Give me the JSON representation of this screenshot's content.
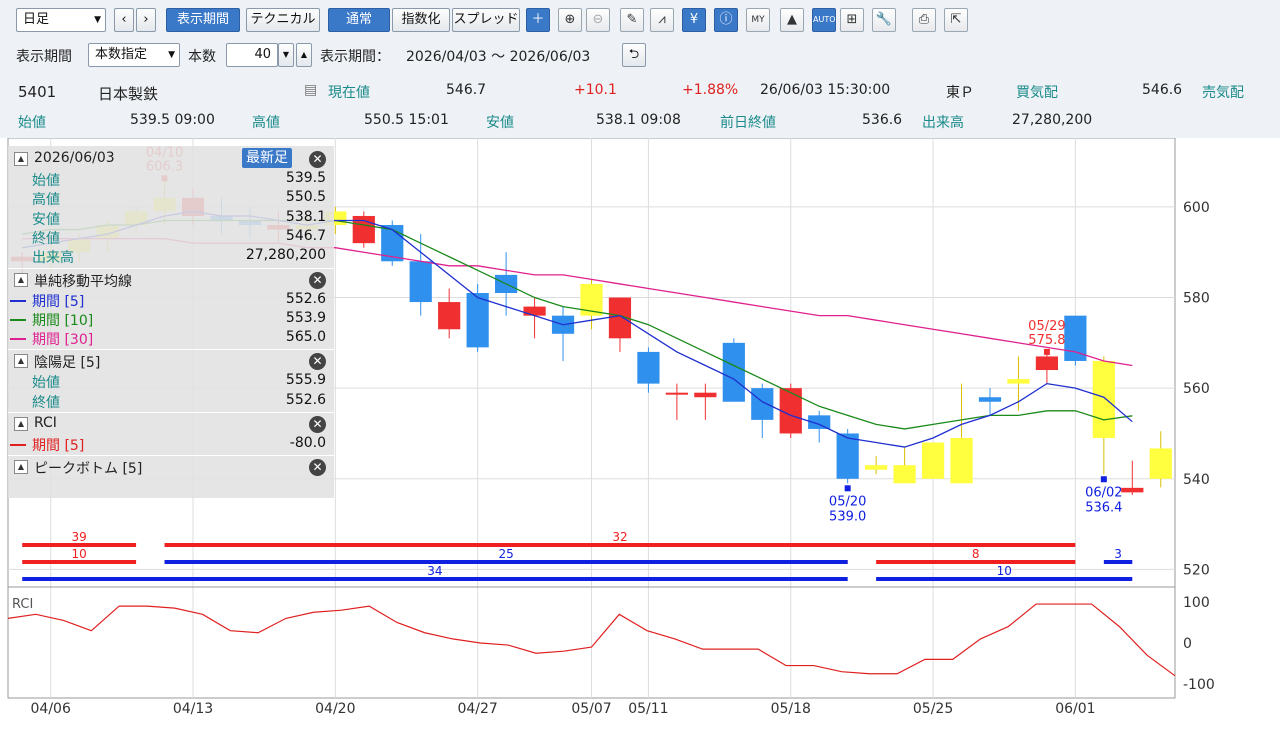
{
  "toolbar": {
    "period_select": "日足",
    "prev": "‹",
    "next": "›",
    "btn_period": "表示期間",
    "btn_tech": "テクニカル",
    "btn_normal": "通常",
    "btn_index": "指数化",
    "btn_spread": "スプレッド",
    "icons": [
      "plus-icon",
      "zoom-in-icon",
      "zoom-out-icon",
      "pencil-icon",
      "chart-compare-icon",
      "yen-icon",
      "info-icon",
      "my-chart-icon",
      "area-chart-icon",
      "auto-fit-icon",
      "tick-chart-icon",
      "wrench-icon",
      "print-icon",
      "export-icon"
    ]
  },
  "row2": {
    "label_period": "表示期間",
    "mode": "本数指定",
    "label_count": "本数",
    "count": "40",
    "label_range": "表示期間：",
    "range": "2026/04/03 〜 2026/06/03"
  },
  "quote": {
    "code": "5401",
    "name": "日本製鉄",
    "current_label": "現在値",
    "current": "546.7",
    "change": "+10.1",
    "change_pct": "+1.88%",
    "datetime": "26/06/03 15:30:00",
    "market": "東Ｐ",
    "bid_label": "買気配",
    "bid": "546.6",
    "ask_label": "売気配",
    "open_label": "始値",
    "open": "539.5 09:00",
    "high_label": "高値",
    "high": "550.5 15:01",
    "low_label": "安値",
    "low": "538.1 09:08",
    "prev_label": "前日終値",
    "prev": "536.6",
    "vol_label": "出来高",
    "vol": "27,280,200"
  },
  "panel": {
    "date": "2026/06/03",
    "latest_btn": "最新足",
    "rows": [
      [
        "始値",
        "539.5"
      ],
      [
        "高値",
        "550.5"
      ],
      [
        "安値",
        "538.1"
      ],
      [
        "終値",
        "546.7"
      ],
      [
        "出来高",
        "27,280,200"
      ]
    ],
    "sma_title": "単純移動平均線",
    "sma": [
      [
        "期間 [5]",
        "552.6",
        "#1f2fd0"
      ],
      [
        "期間 [10]",
        "553.9",
        "#1a8a1a"
      ],
      [
        "期間 [30]",
        "565.0",
        "#e0208f"
      ]
    ],
    "inyou_title": "陰陽足 [5]",
    "inyou": [
      [
        "始値",
        "555.9"
      ],
      [
        "終値",
        "552.6"
      ]
    ],
    "rci_title": "RCI",
    "rci": [
      [
        "期間 [5]",
        "-80.0",
        "#e02020"
      ]
    ],
    "peak_title": "ピークボトム [5]"
  },
  "chart_data": {
    "type": "candlestick",
    "dates": [
      "04/03",
      "04/06",
      "04/07",
      "04/08",
      "04/09",
      "04/10",
      "04/13",
      "04/14",
      "04/15",
      "04/16",
      "04/17",
      "04/20",
      "04/21",
      "04/22",
      "04/23",
      "04/24",
      "04/27",
      "04/28",
      "04/30",
      "05/01",
      "05/07",
      "05/08",
      "05/11",
      "05/12",
      "05/13",
      "05/14",
      "05/15",
      "05/18",
      "05/19",
      "05/20",
      "05/21",
      "05/22",
      "05/25",
      "05/26",
      "05/27",
      "05/28",
      "05/29",
      "06/01",
      "06/02",
      "06/03"
    ],
    "candles": [
      [
        589,
        590,
        585,
        588
      ],
      [
        588,
        592,
        586,
        590
      ],
      [
        590,
        594,
        588,
        593
      ],
      [
        593,
        597,
        590,
        596
      ],
      [
        596,
        600,
        594,
        599
      ],
      [
        599,
        606.3,
        596,
        602
      ],
      [
        602,
        604,
        596,
        598
      ],
      [
        598,
        602,
        594,
        597
      ],
      [
        597,
        600,
        593,
        596
      ],
      [
        596,
        599,
        592,
        595
      ],
      [
        595,
        598,
        592,
        596
      ],
      [
        596,
        600,
        594,
        599
      ],
      [
        598,
        599,
        591,
        592
      ],
      [
        596,
        597,
        587,
        588
      ],
      [
        588,
        594,
        576,
        579
      ],
      [
        579,
        582,
        571,
        573
      ],
      [
        581,
        583,
        568,
        569
      ],
      [
        585,
        590,
        576,
        581
      ],
      [
        578,
        580,
        571,
        576
      ],
      [
        576,
        578,
        566,
        572
      ],
      [
        576,
        584,
        573,
        583
      ],
      [
        580,
        580,
        568,
        571
      ],
      [
        568,
        569,
        559,
        561
      ],
      [
        559,
        561,
        553,
        559
      ],
      [
        559,
        561,
        553,
        558
      ],
      [
        570,
        571,
        557,
        557
      ],
      [
        560,
        561,
        549,
        553
      ],
      [
        560,
        561,
        549,
        550
      ],
      [
        554,
        555,
        548,
        551
      ],
      [
        550,
        551,
        539,
        540
      ],
      [
        542,
        545,
        541,
        543
      ],
      [
        539,
        547,
        542,
        543
      ],
      [
        540,
        548,
        543,
        548
      ],
      [
        539,
        561,
        549,
        549
      ],
      [
        558,
        560,
        554,
        557
      ],
      [
        561,
        567,
        555,
        562
      ],
      [
        567,
        568,
        561,
        564
      ],
      [
        576,
        575.8,
        565,
        566
      ],
      [
        549,
        567,
        541,
        566
      ],
      [
        538,
        544,
        536.4,
        537
      ],
      [
        540,
        550.5,
        538.1,
        546.7
      ]
    ],
    "sma5": [
      591,
      592,
      593,
      594,
      596,
      598,
      599,
      598,
      598,
      597,
      596,
      597,
      597,
      595,
      590,
      585,
      580,
      578,
      576,
      574,
      575,
      576,
      572,
      568,
      565,
      562,
      557,
      554,
      552,
      549,
      548,
      547,
      549,
      552,
      554,
      557,
      561,
      560,
      558,
      552.6
    ],
    "sma10": [
      594,
      595,
      595,
      596,
      596,
      597,
      597,
      597,
      597,
      597,
      597,
      597,
      596,
      595,
      592,
      589,
      586,
      583,
      580,
      578,
      577,
      576,
      574,
      571,
      568,
      565,
      562,
      559,
      556,
      554,
      552,
      551,
      552,
      553,
      554,
      554,
      555,
      555,
      553,
      553.9
    ],
    "sma30": [
      593,
      593,
      593,
      593,
      593,
      593,
      592,
      592,
      592,
      592,
      591,
      591,
      590,
      589,
      588,
      587,
      587,
      586,
      585,
      585,
      584,
      583,
      582,
      581,
      580,
      579,
      578,
      577,
      576,
      576,
      575,
      574,
      573,
      572,
      571,
      570,
      569,
      568,
      566,
      565.0
    ],
    "peak_labels": [
      {
        "text": "04/10",
        "value": "606.3"
      },
      {
        "text": "05/29",
        "value": "575.8"
      }
    ],
    "bottom_labels": [
      {
        "text": "05/20",
        "value": "539.0"
      },
      {
        "text": "06/02",
        "value": "536.4"
      }
    ],
    "price_axis": [
      600,
      580,
      560,
      540,
      520
    ],
    "ylim": [
      517,
      613
    ],
    "trend_red": [
      {
        "label": "39"
      },
      {
        "label": "32"
      }
    ],
    "trend_red2": [
      {
        "label": "10"
      },
      {
        "label": "8"
      }
    ],
    "trend_blue": [
      {
        "label": "25"
      },
      {
        "label": "3"
      }
    ],
    "trend_blue2": [
      {
        "label": "34"
      },
      {
        "label": "10"
      }
    ],
    "rci_label": "RCI",
    "rci": [
      60,
      70,
      55,
      30,
      90,
      90,
      85,
      70,
      30,
      25,
      60,
      75,
      80,
      90,
      50,
      25,
      10,
      0,
      -5,
      -25,
      -20,
      -10,
      70,
      30,
      10,
      -15,
      -15,
      -15,
      -55,
      -55,
      -70,
      -75,
      -75,
      -40,
      -40,
      10,
      40,
      95,
      95,
      95,
      40,
      -30,
      -80
    ],
    "rci_axis": [
      100,
      0,
      -100
    ],
    "x_ticks": [
      "04/06",
      "04/13",
      "04/20",
      "04/27",
      "05/07",
      "05/11",
      "05/18",
      "05/25",
      "06/01"
    ]
  },
  "colors": {
    "up": "#f03030",
    "down": "#3090ee",
    "yang": "#ffff40",
    "sma5": "#1f2fd0",
    "sma10": "#1a8a1a",
    "sma30": "#e0208f",
    "rci": "#e02020"
  }
}
